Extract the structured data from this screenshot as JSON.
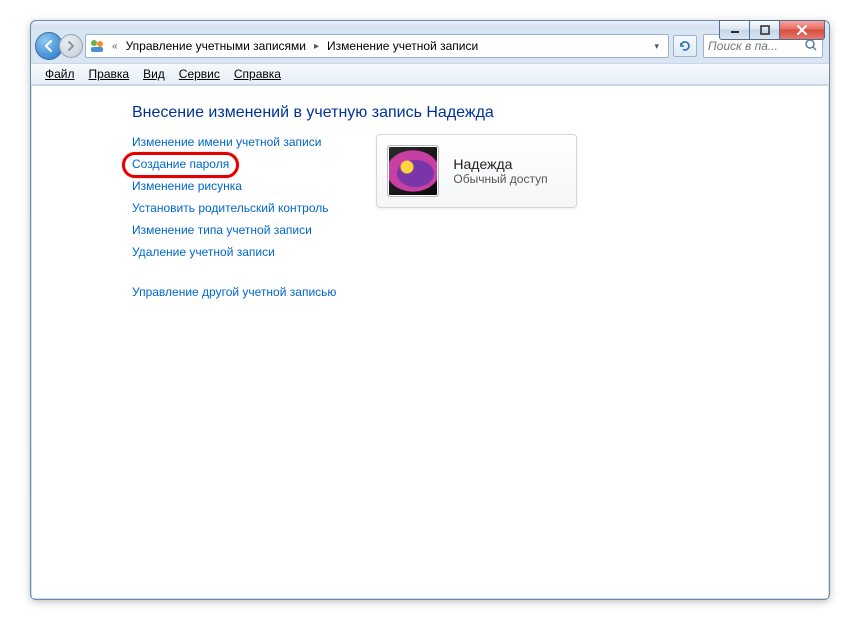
{
  "window": {
    "breadcrumb_prefix": "«",
    "breadcrumb": [
      "Управление учетными записями",
      "Изменение учетной записи"
    ],
    "search_placeholder": "Поиск в па..."
  },
  "menu": {
    "file": "Файл",
    "edit": "Правка",
    "view": "Вид",
    "tools": "Сервис",
    "help": "Справка"
  },
  "page": {
    "heading": "Внесение изменений в учетную запись Надежда",
    "links": [
      "Изменение имени учетной записи",
      "Создание пароля",
      "Изменение рисунка",
      "Установить родительский контроль",
      "Изменение типа учетной записи",
      "Удаление учетной записи"
    ],
    "manage_other": "Управление другой учетной записью"
  },
  "account": {
    "name": "Надежда",
    "type": "Обычный доступ"
  },
  "highlight": {
    "target_link_index": 1
  }
}
